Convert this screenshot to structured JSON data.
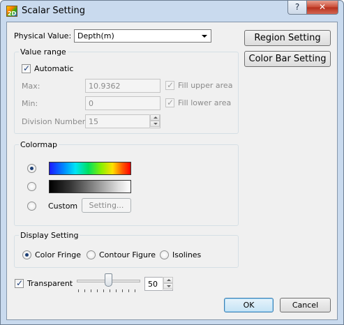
{
  "window": {
    "title": "Scalar Setting",
    "icon": "2D",
    "help_glyph": "?",
    "close_glyph": "✕"
  },
  "physical_value": {
    "label": "Physical Value:",
    "selected": "Depth(m)"
  },
  "buttons": {
    "region": "Region Setting",
    "color_bar": "Color Bar Setting",
    "ok": "OK",
    "cancel": "Cancel",
    "setting": "Setting..."
  },
  "value_range": {
    "title": "Value range",
    "automatic_label": "Automatic",
    "automatic_checked": true,
    "max_label": "Max:",
    "max_value": "10.9362",
    "min_label": "Min:",
    "min_value": "0",
    "fill_upper_label": "Fill upper area",
    "fill_upper_checked": true,
    "fill_lower_label": "Fill lower area",
    "fill_lower_checked": true,
    "division_label": "Division Number:",
    "division_value": "15"
  },
  "colormap": {
    "title": "Colormap",
    "options": [
      "Rainbow",
      "Grayscale",
      "Custom"
    ],
    "selected": "Rainbow",
    "custom_label": "Custom"
  },
  "display_setting": {
    "title": "Display Setting",
    "options": [
      "Color Fringe",
      "Contour Figure",
      "Isolines"
    ],
    "selected": "Color Fringe"
  },
  "transparent": {
    "label": "Transparent",
    "checked": true,
    "value": "50",
    "slider_fraction": 0.5
  },
  "colors": {
    "titlebar": "#c9daee",
    "close_button": "#c94a34",
    "dialog_bg": "#f0f0f0",
    "default_button": "#3c7fb1"
  }
}
